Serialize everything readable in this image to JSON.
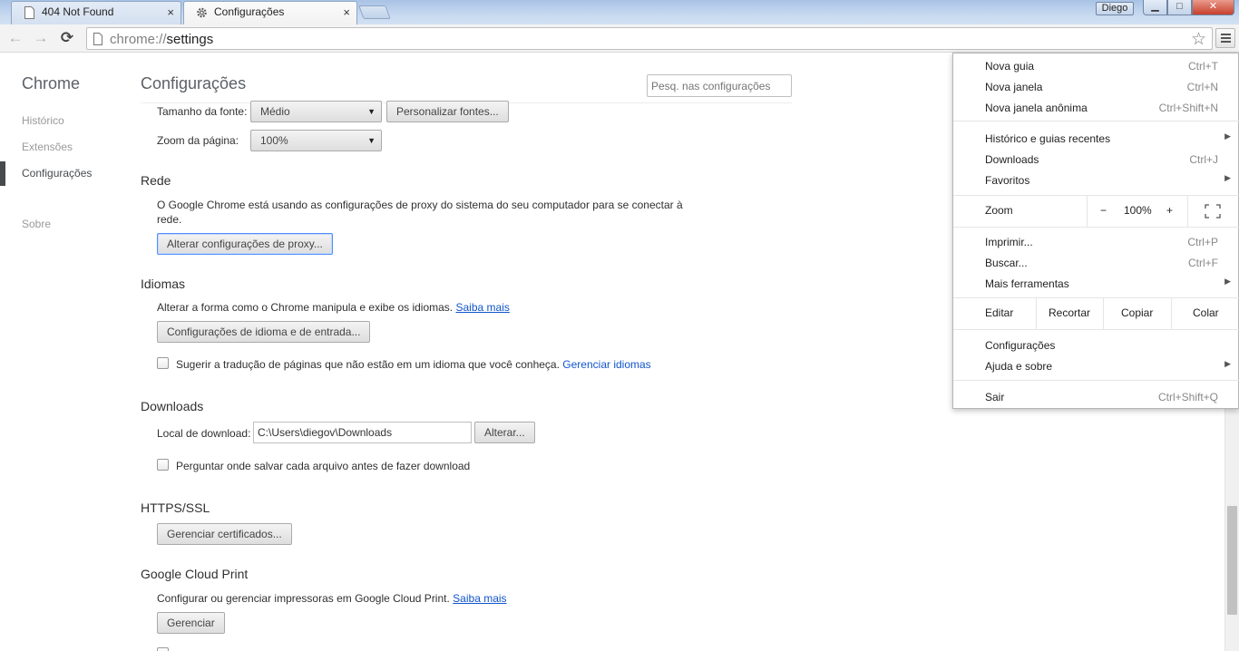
{
  "tabs": [
    {
      "title": "404 Not Found",
      "close": "×"
    },
    {
      "title": "Configurações",
      "close": "×"
    }
  ],
  "window": {
    "profile": "Diego",
    "min": "▁",
    "max": "□",
    "close": "✕"
  },
  "toolbar": {
    "back": "←",
    "forward": "→",
    "reload": "⟳",
    "url_scheme": "chrome://",
    "url_path": "settings",
    "star": "☆"
  },
  "sidebar": {
    "brand": "Chrome",
    "items": [
      {
        "label": "Histórico"
      },
      {
        "label": "Extensões"
      },
      {
        "label": "Configurações"
      },
      {
        "label": "Sobre"
      }
    ]
  },
  "main": {
    "title": "Configurações",
    "search_placeholder": "Pesq. nas configurações",
    "font_size_label": "Tamanho da fonte:",
    "font_size_value": "Médio",
    "customize_fonts": "Personalizar fontes...",
    "page_zoom_label": "Zoom da página:",
    "page_zoom_value": "100%",
    "network": {
      "title": "Rede",
      "desc_line1": "O Google Chrome está usando as configurações de proxy do sistema do seu computador para se conectar à",
      "desc_line2": "rede.",
      "button": "Alterar configurações de proxy..."
    },
    "languages": {
      "title": "Idiomas",
      "desc": "Alterar a forma como o Chrome manipula e exibe os idiomas.",
      "learn_more": "Saiba mais",
      "button": "Configurações de idioma e de entrada...",
      "translate_label": "Sugerir a tradução de páginas que não estão em um idioma que você conheça.",
      "manage_link": "Gerenciar idiomas"
    },
    "downloads": {
      "title": "Downloads",
      "location_label": "Local de download:",
      "location_value": "C:\\Users\\diegov\\Downloads",
      "change_button": "Alterar...",
      "ask_label": "Perguntar onde salvar cada arquivo antes de fazer download"
    },
    "https": {
      "title": "HTTPS/SSL",
      "button": "Gerenciar certificados..."
    },
    "cloud_print": {
      "title": "Google Cloud Print",
      "desc": "Configurar ou gerenciar impressoras em Google Cloud Print.",
      "learn_more": "Saiba mais",
      "button": "Gerenciar"
    }
  },
  "menu": {
    "new_tab": {
      "label": "Nova guia",
      "shortcut": "Ctrl+T"
    },
    "new_window": {
      "label": "Nova janela",
      "shortcut": "Ctrl+N"
    },
    "incognito": {
      "label": "Nova janela anônima",
      "shortcut": "Ctrl+Shift+N"
    },
    "history": {
      "label": "Histórico e guias recentes"
    },
    "downloads": {
      "label": "Downloads",
      "shortcut": "Ctrl+J"
    },
    "bookmarks": {
      "label": "Favoritos"
    },
    "zoom": {
      "label": "Zoom",
      "minus": "−",
      "value": "100%",
      "plus": "+"
    },
    "print": {
      "label": "Imprimir...",
      "shortcut": "Ctrl+P"
    },
    "find": {
      "label": "Buscar...",
      "shortcut": "Ctrl+F"
    },
    "more_tools": {
      "label": "Mais ferramentas"
    },
    "edit": {
      "label": "Editar",
      "cut": "Recortar",
      "copy": "Copiar",
      "paste": "Colar"
    },
    "settings": {
      "label": "Configurações"
    },
    "help": {
      "label": "Ajuda e sobre"
    },
    "exit": {
      "label": "Sair",
      "shortcut": "Ctrl+Shift+Q"
    }
  },
  "colors": {
    "accent": "#4d90fe",
    "link": "#1155cc",
    "nav_selected": "#464a4d"
  }
}
